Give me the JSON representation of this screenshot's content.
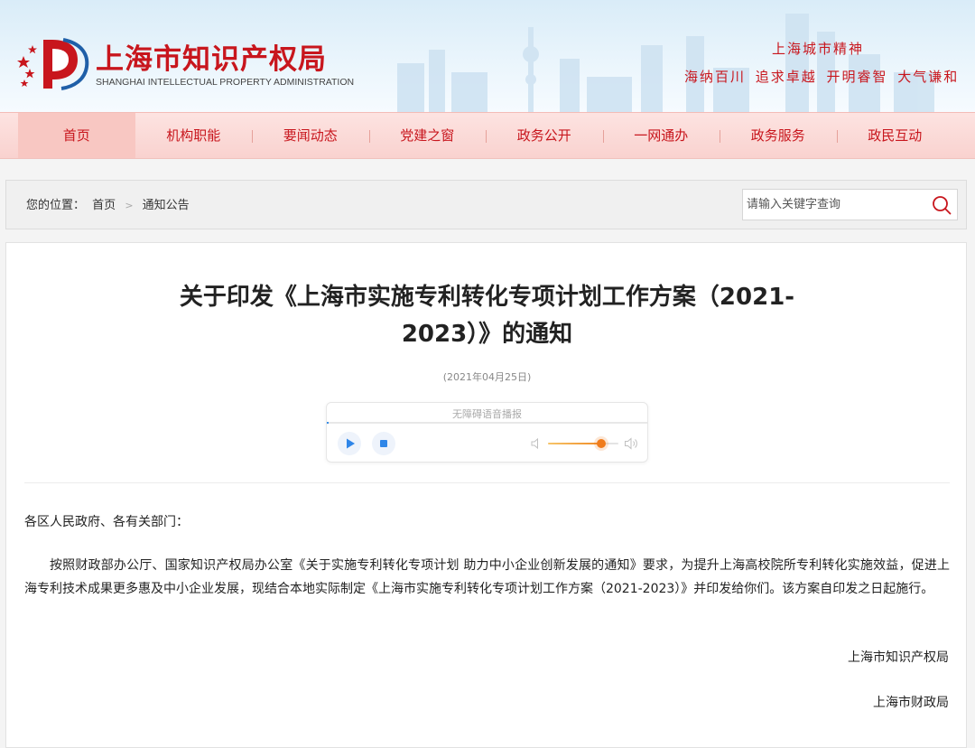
{
  "header": {
    "title": "上海市知识产权局",
    "title_en": "SHANGHAI INTELLECTUAL PROPERTY ADMINISTRATION",
    "slogan_heading": "上海城市精神",
    "slogan_text": "海纳百川 追求卓越 开明睿智 大气谦和"
  },
  "nav": {
    "items": [
      {
        "label": "首页"
      },
      {
        "label": "机构职能"
      },
      {
        "label": "要闻动态"
      },
      {
        "label": "党建之窗"
      },
      {
        "label": "政务公开"
      },
      {
        "label": "一网通办"
      },
      {
        "label": "政务服务"
      },
      {
        "label": "政民互动"
      }
    ],
    "active": "首页"
  },
  "breadcrumb": {
    "prefix": "您的位置：",
    "items": [
      "首页",
      "通知公告"
    ],
    "separator": ">"
  },
  "search": {
    "placeholder": "请输入关键字查询",
    "icon": "search-icon"
  },
  "article": {
    "title_line1": "关于印发《上海市实施专利转化专项计划工作方案（2021-",
    "title_line2": "2023）》的通知",
    "date": "(2021年04月25日)",
    "salutation": "各区人民政府、各有关部门：",
    "paragraph": "按照财政部办公厅、国家知识产权局办公室《关于实施专利转化专项计划 助力中小企业创新发展的通知》要求，为提升上海高校院所专利转化实施效益，促进上海专利技术成果更多惠及中小企业发展，现结合本地实际制定《上海市实施专利转化专项计划工作方案（2021-2023）》并印发给你们。该方案自印发之日起施行。",
    "signatures": [
      "上海市知识产权局",
      "上海市财政局"
    ]
  },
  "audio_player": {
    "label": "无障碍语音播报",
    "icons": [
      "play-icon",
      "stop-icon",
      "volume-low-icon",
      "volume-high-icon"
    ],
    "volume": 0.75
  },
  "colors": {
    "brand_red": "#c8161d",
    "nav_bg": "#fde3e1",
    "accent_orange": "#f07c1c"
  }
}
